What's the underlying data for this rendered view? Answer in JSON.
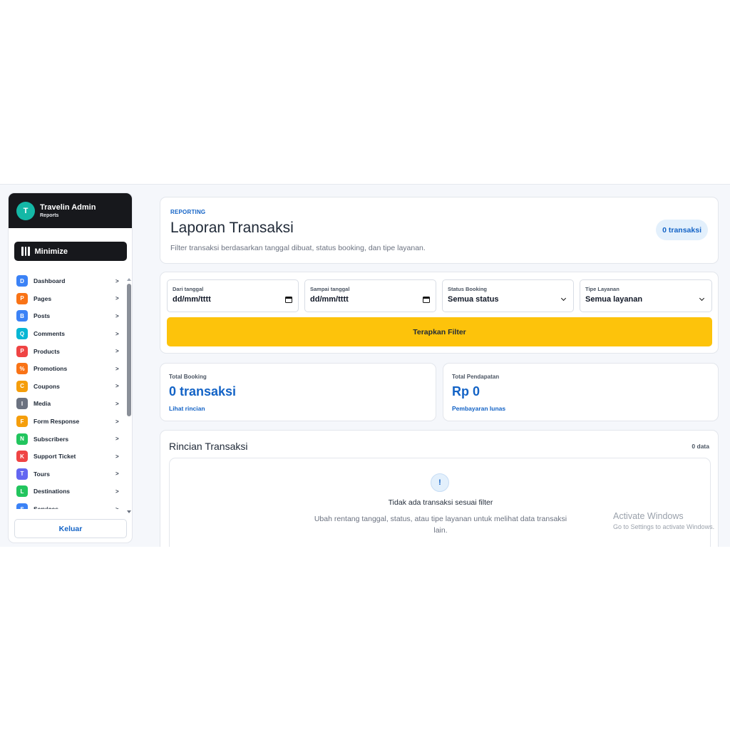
{
  "sidebar": {
    "avatar_letter": "T",
    "title": "Travelin Admin",
    "subtitle": "Reports",
    "minimize_label": "Minimize",
    "items": [
      {
        "letter": "D",
        "label": "Dashboard",
        "chevron": ">",
        "color": "#3b82f6"
      },
      {
        "letter": "P",
        "label": "Pages",
        "chevron": ">",
        "color": "#f97316"
      },
      {
        "letter": "B",
        "label": "Posts",
        "chevron": ">",
        "color": "#3b82f6"
      },
      {
        "letter": "Q",
        "label": "Comments",
        "chevron": ">",
        "color": "#06b6d4"
      },
      {
        "letter": "P",
        "label": "Products",
        "chevron": ">",
        "color": "#ef4444"
      },
      {
        "letter": "%",
        "label": "Promotions",
        "chevron": ">",
        "color": "#f97316"
      },
      {
        "letter": "C",
        "label": "Coupons",
        "chevron": ">",
        "color": "#f59e0b"
      },
      {
        "letter": "I",
        "label": "Media",
        "chevron": ">",
        "color": "#6b7280"
      },
      {
        "letter": "F",
        "label": "Form Response",
        "chevron": ">",
        "color": "#f59e0b"
      },
      {
        "letter": "N",
        "label": "Subscribers",
        "chevron": ">",
        "color": "#22c55e"
      },
      {
        "letter": "K",
        "label": "Support Ticket",
        "chevron": ">",
        "color": "#ef4444"
      },
      {
        "letter": "T",
        "label": "Tours",
        "chevron": ">",
        "color": "#6366f1"
      },
      {
        "letter": "L",
        "label": "Destinations",
        "chevron": ">",
        "color": "#22c55e"
      },
      {
        "letter": "S",
        "label": "Services",
        "chevron": ">",
        "color": "#3b82f6"
      }
    ],
    "logout_label": "Keluar"
  },
  "header": {
    "eyebrow": "REPORTING",
    "title": "Laporan Transaksi",
    "description": "Filter transaksi berdasarkan tanggal dibuat, status booking, dan tipe layanan.",
    "badge": "0 transaksi"
  },
  "filters": {
    "date_from": {
      "label": "Dari tanggal",
      "value": "dd/mm/tttt"
    },
    "date_to": {
      "label": "Sampai tanggal",
      "value": "dd/mm/tttt"
    },
    "status": {
      "label": "Status Booking",
      "value": "Semua status"
    },
    "service_type": {
      "label": "Tipe Layanan",
      "value": "Semua layanan"
    },
    "apply_label": "Terapkan Filter"
  },
  "stats": {
    "total_booking": {
      "label": "Total Booking",
      "value": "0 transaksi",
      "link": "Lihat rincian"
    },
    "total_revenue": {
      "label": "Total Pendapatan",
      "value": "Rp 0",
      "link": "Pembayaran lunas"
    }
  },
  "details": {
    "title": "Rincian Transaksi",
    "count": "0 data",
    "empty_icon": "!",
    "empty_title": "Tidak ada transaksi sesuai filter",
    "empty_description": "Ubah rentang tanggal, status, atau tipe layanan untuk melihat data transaksi lain."
  },
  "watermark": {
    "title": "Activate Windows",
    "subtitle": "Go to Settings to activate Windows."
  },
  "colors": {
    "accent_blue": "#1363c6",
    "apply_yellow": "#fdc30b",
    "sidebar_dark": "#17181c"
  }
}
